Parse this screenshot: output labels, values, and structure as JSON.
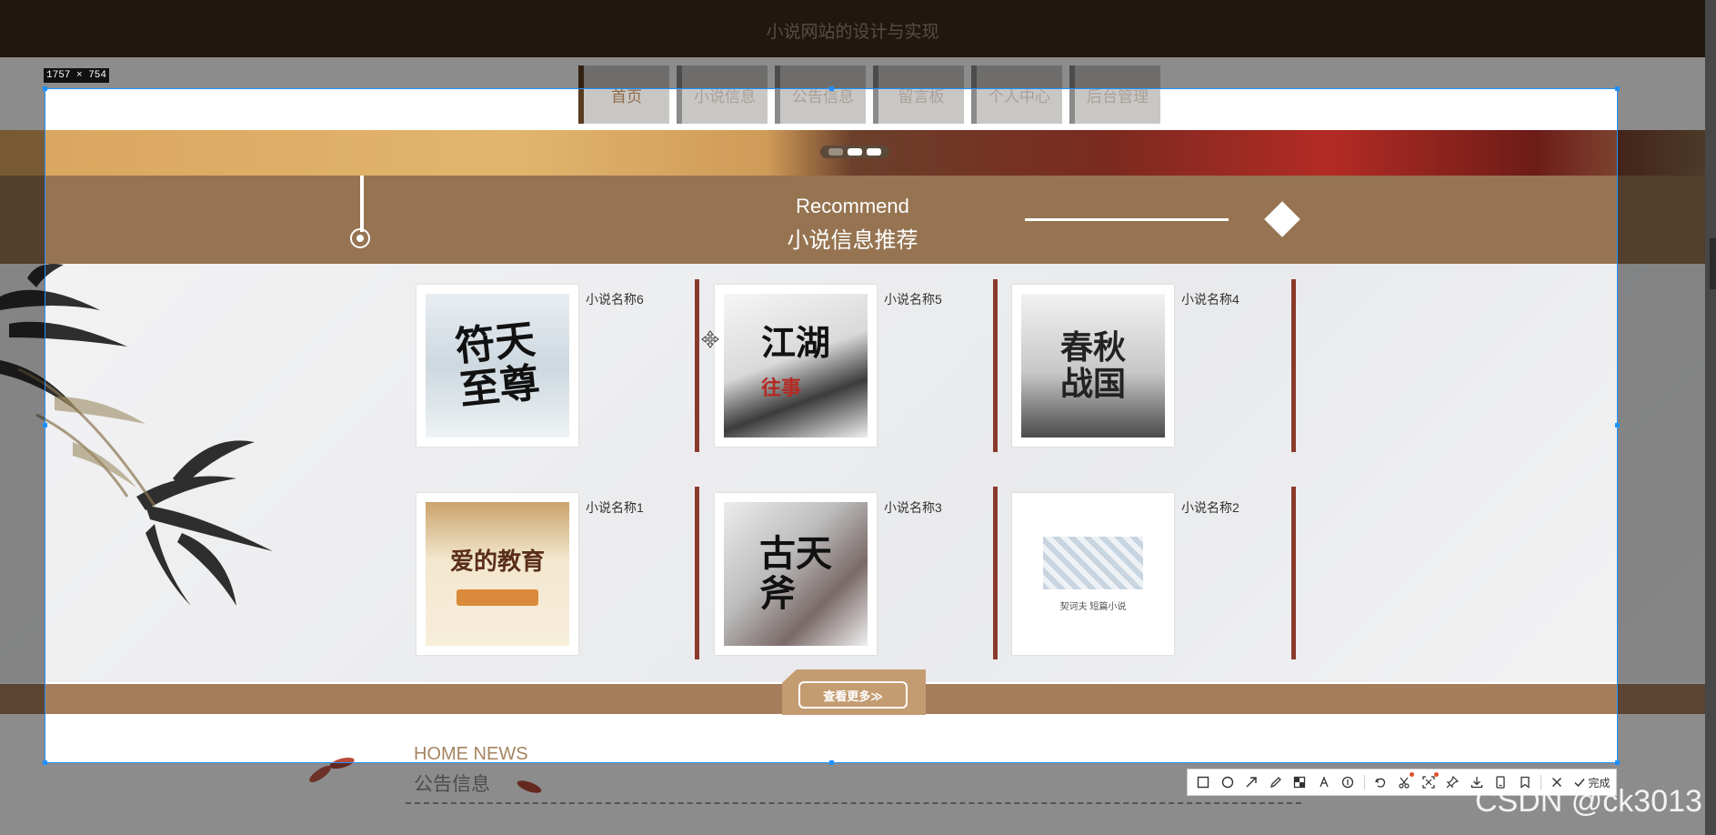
{
  "site": {
    "title": "小说网站的设计与实现"
  },
  "nav": {
    "items": [
      {
        "label": "首页",
        "active": true
      },
      {
        "label": "小说信息",
        "active": false
      },
      {
        "label": "公告信息",
        "active": false
      },
      {
        "label": "留言板",
        "active": false
      },
      {
        "label": "个人中心",
        "active": false
      },
      {
        "label": "后台管理",
        "active": false
      }
    ]
  },
  "recommend": {
    "en": "Recommend",
    "cn": "小说信息推荐"
  },
  "books": [
    {
      "title": "小说名称6",
      "cover_text": "符天至尊"
    },
    {
      "title": "小说名称5",
      "cover_text": "江湖往事"
    },
    {
      "title": "小说名称4",
      "cover_text": "春秋战国"
    },
    {
      "title": "小说名称1",
      "cover_text": "爱的教育"
    },
    {
      "title": "小说名称3",
      "cover_text": "古天斧"
    },
    {
      "title": "小说名称2",
      "cover_text": "契诃夫 短篇小说"
    }
  ],
  "more": {
    "label": "查看更多≫"
  },
  "news": {
    "en": "HOME NEWS",
    "cn": "公告信息"
  },
  "capture": {
    "size_label": "1757 × 754",
    "done_label": "完成",
    "tools": [
      "rectangle-icon",
      "ellipse-icon",
      "arrow-icon",
      "pencil-icon",
      "mosaic-icon",
      "text-icon",
      "number-icon",
      "undo-icon",
      "cut-icon",
      "region-icon",
      "pin-icon",
      "download-icon",
      "device-icon",
      "bookmark-icon",
      "close-icon",
      "check-icon"
    ]
  },
  "watermark": {
    "text": "CSDN @ck3013"
  },
  "colors": {
    "topbar": "#3b2b1c",
    "accent_band": "#967451",
    "divider": "#8a3a2c",
    "selection": "#1e90ff"
  }
}
